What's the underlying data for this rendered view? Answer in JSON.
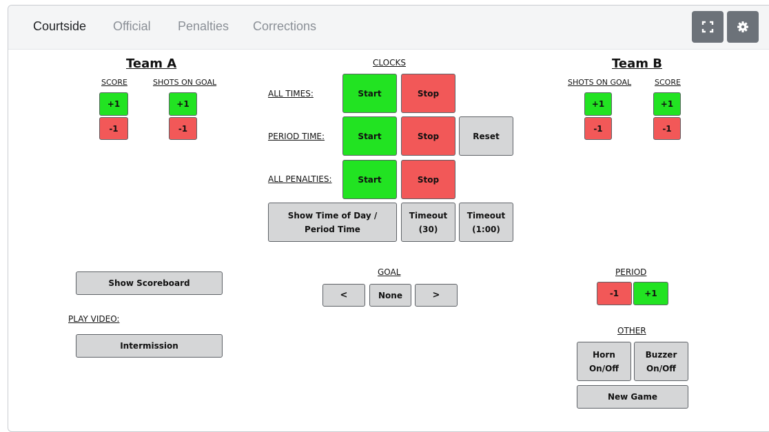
{
  "tabs": [
    "Courtside",
    "Official",
    "Penalties",
    "Corrections"
  ],
  "header_icons": {
    "fullscreen": "fullscreen-icon",
    "settings": "gear-icon"
  },
  "colors": {
    "green": "#22e322",
    "red": "#f25858",
    "gray_button": "#d5d6d7",
    "icon_button": "#6c7279"
  },
  "team_a": {
    "name": "Team A",
    "score_label": "SCORE",
    "shots_label": "SHOTS ON GOAL",
    "plus": "+1",
    "minus": "-1"
  },
  "team_b": {
    "name": "Team B",
    "score_label": "SCORE",
    "shots_label": "SHOTS ON GOAL",
    "plus": "+1",
    "minus": "-1"
  },
  "clocks": {
    "title": "CLOCKS",
    "all_times_label": "ALL TIMES:",
    "period_time_label": "PERIOD TIME:",
    "all_penalties_label": "ALL PENALTIES:",
    "start": "Start",
    "stop": "Stop",
    "reset": "Reset",
    "show_time_of_day": [
      "Show Time of Day /",
      "Period Time"
    ],
    "timeout_30": [
      "Timeout",
      "(30)"
    ],
    "timeout_100": [
      "Timeout",
      "(1:00)"
    ]
  },
  "goal": {
    "title": "GOAL",
    "prev": "<",
    "value": "None",
    "next": ">"
  },
  "period": {
    "title": "PERIOD",
    "minus": "-1",
    "plus": "+1"
  },
  "left_panel": {
    "show_scoreboard": "Show Scoreboard",
    "play_video_label": "PLAY VIDEO:",
    "intermission": "Intermission"
  },
  "other": {
    "title": "OTHER",
    "horn": [
      "Horn",
      "On/Off"
    ],
    "buzzer": [
      "Buzzer",
      "On/Off"
    ],
    "new_game": "New Game"
  }
}
